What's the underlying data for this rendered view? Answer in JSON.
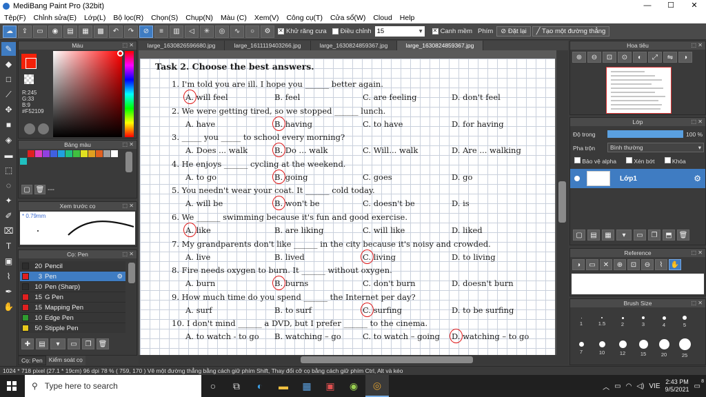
{
  "app": {
    "title": "MediBang Paint Pro (32bit)"
  },
  "window_buttons": [
    "—",
    "☐",
    "✕"
  ],
  "menu": [
    "Tệp(F)",
    "Chỉnh sửa(E)",
    "Lớp(L)",
    "Bộ lọc(R)",
    "Chọn(S)",
    "Chụp(N)",
    "Màu (C)",
    "Xem(V)",
    "Công cụ(T)",
    "Cửa sổ(W)",
    "Cloud",
    "Help"
  ],
  "toolbar": {
    "antialias_label": "Khử răng cưa",
    "correction_label": "Điều chỉnh",
    "correction_value": "15",
    "canh_mem_label": "Canh mềm",
    "phim_label": "Phím",
    "reset_label": "Đặt lại",
    "create_line_label": "Tạo một đường thẳng"
  },
  "color_panel": {
    "title": "Màu",
    "r": "R:245",
    "g": "G:33",
    "b": "B:9",
    "hex": "#F52109",
    "primary_color": "#F52109"
  },
  "palette_panel": {
    "title": "Bảng màu",
    "more": "---"
  },
  "preview_panel": {
    "title": "Xem trước cọ",
    "size": "0.79mm"
  },
  "brush_panel": {
    "title": "Cọ: Pen",
    "items": [
      {
        "num": "20",
        "name": "Pencil",
        "color": "#2d2d2d"
      },
      {
        "num": "3",
        "name": "Pen",
        "color": "#e02020"
      },
      {
        "num": "10",
        "name": "Pen (Sharp)",
        "color": "#2d2d2d"
      },
      {
        "num": "15",
        "name": "G Pen",
        "color": "#e02020"
      },
      {
        "num": "15",
        "name": "Mapping Pen",
        "color": "#e02020"
      },
      {
        "num": "10",
        "name": "Edge Pen",
        "color": "#2f9a2f"
      },
      {
        "num": "50",
        "name": "Stipple Pen",
        "color": "#e8c81c"
      }
    ],
    "tab1": "Cọ: Pen",
    "tab2": "Kiểm soát cọ"
  },
  "tabs": [
    "large_1630826596680.jpg",
    "large_1611119403266.jpg",
    "large_1630824859367.jpg",
    "large_1630824859367.jpg"
  ],
  "worksheet": {
    "heading": "Task 2. Choose the best answers.",
    "questions": [
      {
        "q": "1.   I'm told you are ill. I hope you ______ better again.",
        "opts": [
          "A. will feel",
          "B. feel",
          "C. are feeling",
          "D. don't feel"
        ]
      },
      {
        "q": "2.   We were getting tired, so we stopped ______ lunch.",
        "opts": [
          "A. have",
          "B. having",
          "C. to have",
          "D. for having"
        ]
      },
      {
        "q": "3.   _____ you _____ to school every morning?",
        "opts": [
          "A. Does ... walk",
          "B. Do ... walk",
          "C. Will... walk",
          "D. Are ... walking"
        ]
      },
      {
        "q": "4.   He enjoys ______ cycling at the weekend.",
        "opts": [
          "A. to go",
          "B. going",
          "C. goes",
          "D. go"
        ]
      },
      {
        "q": "5.   You needn't wear your coat. It ______ cold today.",
        "opts": [
          "A. will be",
          "B. won't be",
          "C. doesn't be",
          "D. is"
        ]
      },
      {
        "q": "6.   We ______ swimming  because it's fun and good exercise.",
        "opts": [
          "A. like",
          "B. are liking",
          "C. will like",
          "D. liked"
        ]
      },
      {
        "q": "7.   My grandparents don't like ______ in the city  because it's noisy and crowded.",
        "opts": [
          "A. live",
          "B. lived",
          "C. living",
          "D. to living"
        ]
      },
      {
        "q": "8.   Fire needs oxygen to burn. It ______ without oxygen.",
        "opts": [
          "A. burn",
          "B. burns",
          "C. don't burn",
          "D. doesn't burn"
        ]
      },
      {
        "q": "9.   How much time do you spend ______ the Internet per day?",
        "opts": [
          "A. surf",
          "B. to surf",
          "C. surfing",
          "D. to be surfing"
        ]
      },
      {
        "q": "10. I don't mind ______ a DVD, but I prefer ______ to the cinema.",
        "opts": [
          "A. to watch - to go",
          "B. watching – go",
          "C. to watch – going",
          "D. watching – to go"
        ]
      }
    ],
    "answers": [
      0,
      1,
      1,
      1,
      1,
      0,
      2,
      1,
      2,
      3
    ]
  },
  "navigator": {
    "title": "Hoa tiêu"
  },
  "layer_panel": {
    "title": "Lớp",
    "opacity_label": "Độ trong",
    "opacity_value": "100 %",
    "opacity_fraction": 1.0,
    "blend_label": "Pha trộn",
    "blend_value": "Bình thường",
    "protect_alpha": "Bảo vệ alpha",
    "clipping": "Xén bớt",
    "lock": "Khóa",
    "layer_name": "Lớp1"
  },
  "reference_panel": {
    "title": "Reference"
  },
  "brush_size_panel": {
    "title": "Brush Size",
    "sizes_row1": [
      "1",
      "1.5",
      "2",
      "3",
      "4",
      "5"
    ],
    "sizes_row2": [
      "7",
      "10",
      "12",
      "15",
      "20",
      "25"
    ]
  },
  "status": {
    "text": "1024 * 718 pixel  (27.1 * 19cm)  96 dpi  78 %  ( 759, 170 )  Vẽ một đường thẳng bằng cách giữ phím Shift, Thay đổi cỡ cọ bằng cách giữ phím Ctrl, Alt và kéo"
  },
  "taskbar": {
    "search_placeholder": "Type here to search",
    "lang": "VIE",
    "time": "2:43 PM",
    "date": "9/5/2021",
    "notif_count": "8"
  }
}
